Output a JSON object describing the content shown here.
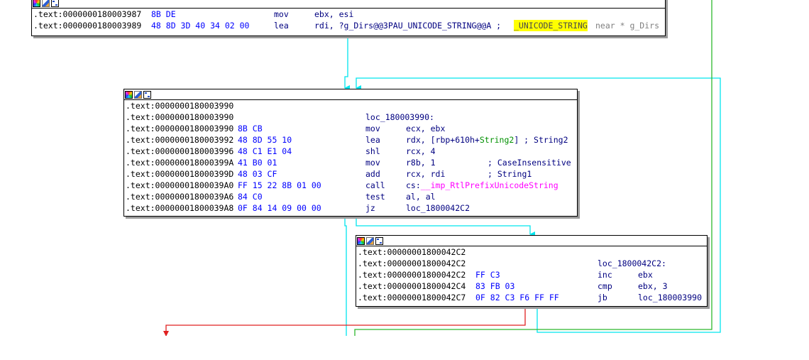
{
  "toolbar_icons": [
    "color-palette-icon",
    "edit-node-icon",
    "graph-node-icon"
  ],
  "colors": {
    "edge_cyan": "#00e5ee",
    "edge_green": "#2eb82e",
    "edge_red": "#e02020",
    "address": "#000000",
    "bytes": "#0000ff",
    "instruction": "#000080",
    "import": "#ff00ff",
    "highlight": "#ffff00"
  },
  "block1": {
    "rows": [
      {
        "addr": ".text:0000000180003987",
        "bytes": "8B DE",
        "mnem": "mov",
        "ops": "ebx, esi"
      },
      {
        "addr": ".text:0000000180003989",
        "bytes": "48 8D 3D 40 34 02 00",
        "mnem": "lea",
        "ops": "rdi, ?g_Dirs@@3PAU_UNICODE_STRING@@A ;",
        "type": "_UNICODE_STRING",
        "tail": "near * g_Dirs"
      }
    ]
  },
  "block2": {
    "rows": [
      {
        "addr": ".text:0000000180003990"
      },
      {
        "addr": ".text:0000000180003990",
        "label": "loc_180003990:"
      },
      {
        "addr": ".text:0000000180003990",
        "bytes": "8B CB",
        "mnem": "mov",
        "ops": "ecx, ebx"
      },
      {
        "addr": ".text:0000000180003992",
        "bytes": "48 8D 55 10",
        "mnem": "lea",
        "ops_pre": "rdx, [rbp+610h+",
        "ops_green": "String2",
        "ops_post": "] ; String2"
      },
      {
        "addr": ".text:0000000180003996",
        "bytes": "48 C1 E1 04",
        "mnem": "shl",
        "ops": "rcx, 4"
      },
      {
        "addr": ".text:000000018000399A",
        "bytes": "41 B0 01",
        "mnem": "mov",
        "ops": "r8b, 1",
        "comment": "; CaseInsensitive"
      },
      {
        "addr": ".text:000000018000399D",
        "bytes": "48 03 CF",
        "mnem": "add",
        "ops": "rcx, rdi",
        "comment": "; String1"
      },
      {
        "addr": ".text:00000001800039A0",
        "bytes": "FF 15 22 8B 01 00",
        "mnem": "call",
        "ops_pre": "cs:",
        "ops_imp": "__imp_RtlPrefixUnicodeString"
      },
      {
        "addr": ".text:00000001800039A6",
        "bytes": "84 C0",
        "mnem": "test",
        "ops": "al, al"
      },
      {
        "addr": ".text:00000001800039A8",
        "bytes": "0F 84 14 09 00 00",
        "mnem": "jz",
        "ops": "loc_1800042C2"
      }
    ]
  },
  "block3": {
    "rows": [
      {
        "addr": ".text:00000001800042C2"
      },
      {
        "addr": ".text:00000001800042C2",
        "label": "loc_1800042C2:"
      },
      {
        "addr": ".text:00000001800042C2",
        "bytes": "FF C3",
        "mnem": "inc",
        "ops": "ebx"
      },
      {
        "addr": ".text:00000001800042C4",
        "bytes": "83 FB 03",
        "mnem": "cmp",
        "ops": "ebx, 3"
      },
      {
        "addr": ".text:00000001800042C7",
        "bytes": "0F 82 C3 F6 FF FF",
        "mnem": "jb",
        "ops": "loc_180003990"
      }
    ]
  }
}
